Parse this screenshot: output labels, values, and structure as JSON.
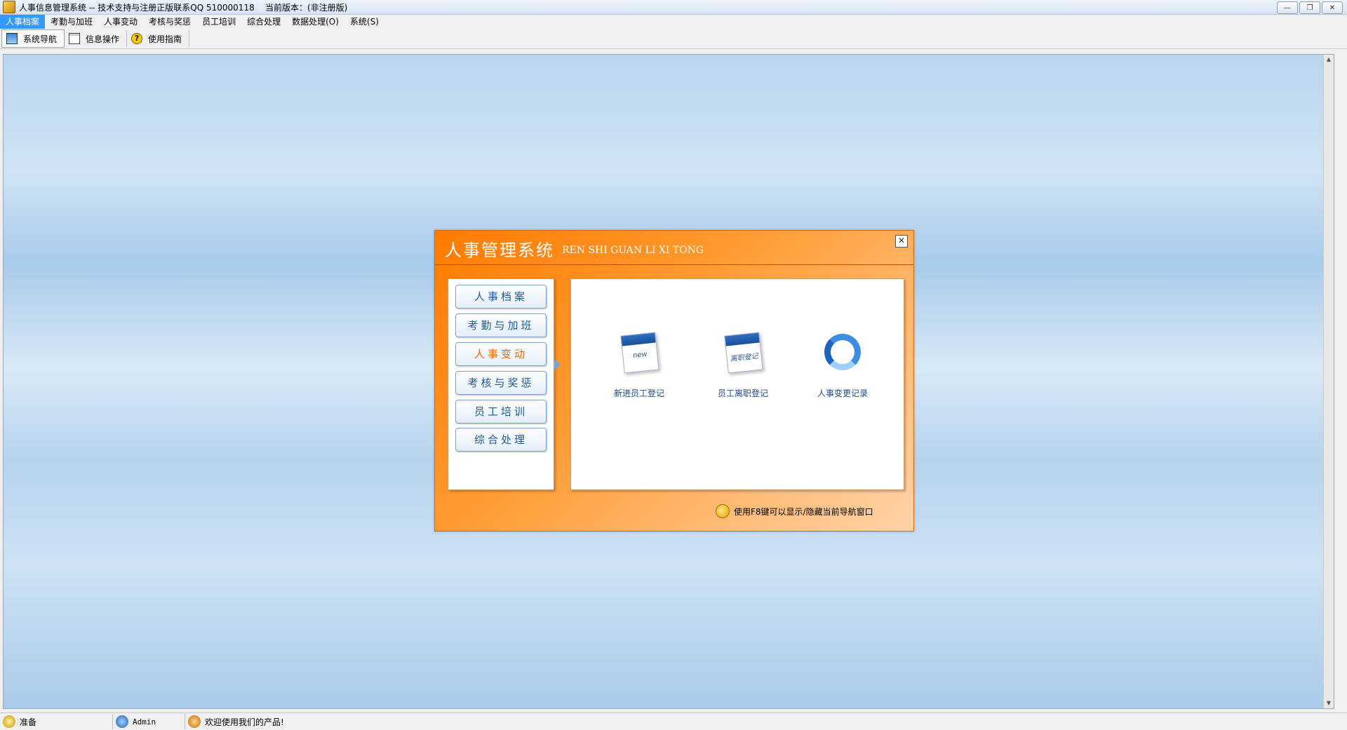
{
  "window": {
    "title": "人事信息管理系统 -- 技术支持与注册正版联系QQ 510000118    当前版本：(非注册版)",
    "buttons": {
      "minimize": "—",
      "restore": "❐",
      "close": "✕"
    }
  },
  "menu": [
    "人事档案",
    "考勤与加班",
    "人事变动",
    "考核与奖惩",
    "员工培训",
    "综合处理",
    "数据处理(O)",
    "系统(S)"
  ],
  "toolbar": [
    {
      "label": "系统导航",
      "icon": "nav-icon"
    },
    {
      "label": "信息操作",
      "icon": "document-icon"
    },
    {
      "label": "使用指南",
      "icon": "help-icon"
    }
  ],
  "navpanel": {
    "title": "人事管理系统",
    "subtitle": "REN SHI GUAN LI XI TONG",
    "close": "✕",
    "left_buttons": [
      "人事档案",
      "考勤与加班",
      "人事变动",
      "考核与奖惩",
      "员工培训",
      "综合处理"
    ],
    "active_index": 2,
    "functions": [
      {
        "label": "新进员工登记",
        "icon_text": "new"
      },
      {
        "label": "员工离职登记",
        "icon_text": "离职登记"
      },
      {
        "label": "人事变更记录",
        "icon_text": ""
      }
    ],
    "hint": "使用F8键可以显示/隐藏当前导航窗口"
  },
  "status": {
    "ready": "准备",
    "user": "Admin",
    "welcome": "欢迎使用我们的产品!"
  }
}
